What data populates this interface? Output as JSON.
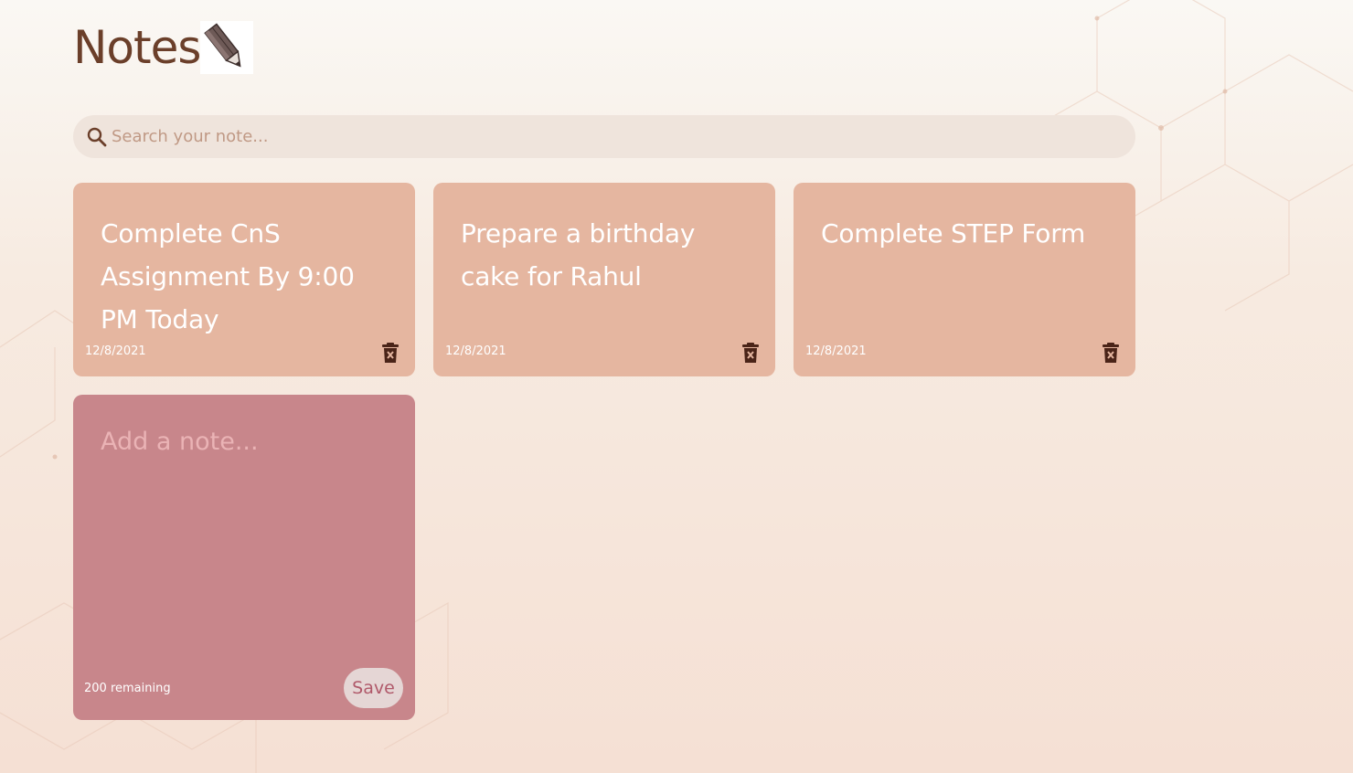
{
  "app": {
    "title": "Notes",
    "logo_icon": "pencil-icon"
  },
  "search": {
    "placeholder": "Search your note...",
    "icon": "search-icon"
  },
  "notes": [
    {
      "text": "Complete CnS Assignment By 9:00 PM Today",
      "date": "12/8/2021",
      "delete_icon": "trash-icon"
    },
    {
      "text": "Prepare a birthday cake for Rahul",
      "date": "12/8/2021",
      "delete_icon": "trash-icon"
    },
    {
      "text": "Complete STEP Form",
      "date": "12/8/2021",
      "delete_icon": "trash-icon"
    }
  ],
  "new_note": {
    "placeholder": "Add a note...",
    "remaining_text": "200 remaining",
    "save_label": "Save"
  },
  "colors": {
    "note_card": "#e5b6a0",
    "new_note_card": "#c8868b",
    "title": "#6b3f2a",
    "search_bg": "#efe4dc",
    "save_button_bg": "#e5d6d5",
    "save_button_text": "#b0596a",
    "delete_icon": "#4a2418"
  }
}
